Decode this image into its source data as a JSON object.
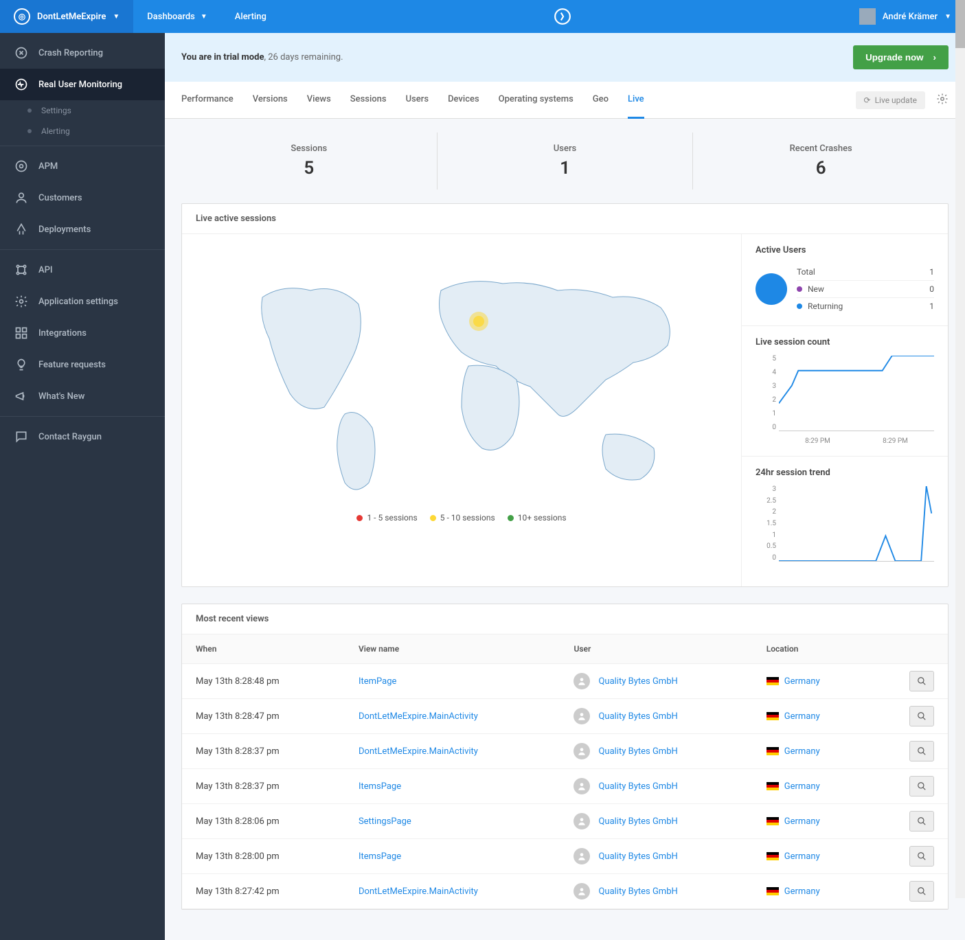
{
  "topbar": {
    "app_name": "DontLetMeExpire",
    "nav": [
      "Dashboards",
      "Alerting"
    ],
    "user_name": "André Krämer"
  },
  "sidebar": {
    "sections": [
      {
        "items": [
          {
            "label": "Crash Reporting",
            "icon": "crash"
          },
          {
            "label": "Real User Monitoring",
            "icon": "pulse",
            "active": true,
            "subitems": [
              "Settings",
              "Alerting"
            ]
          }
        ]
      },
      {
        "items": [
          {
            "label": "APM",
            "icon": "apm"
          },
          {
            "label": "Customers",
            "icon": "customers"
          },
          {
            "label": "Deployments",
            "icon": "deployments"
          }
        ]
      },
      {
        "items": [
          {
            "label": "API",
            "icon": "api"
          },
          {
            "label": "Application settings",
            "icon": "gear"
          },
          {
            "label": "Integrations",
            "icon": "integrations"
          },
          {
            "label": "Feature requests",
            "icon": "bulb"
          },
          {
            "label": "What's New",
            "icon": "megaphone"
          }
        ]
      },
      {
        "items": [
          {
            "label": "Contact Raygun",
            "icon": "chat"
          }
        ]
      }
    ]
  },
  "trial": {
    "bold": "You are in trial mode",
    "rest": ", 26 days remaining.",
    "upgrade": "Upgrade now"
  },
  "tabs": {
    "items": [
      "Performance",
      "Versions",
      "Views",
      "Sessions",
      "Users",
      "Devices",
      "Operating systems",
      "Geo",
      "Live"
    ],
    "active": "Live",
    "live_update": "Live update"
  },
  "kpis": [
    {
      "label": "Sessions",
      "value": "5"
    },
    {
      "label": "Users",
      "value": "1"
    },
    {
      "label": "Recent Crashes",
      "value": "6"
    }
  ],
  "map_panel": {
    "title": "Live active sessions",
    "legend": [
      {
        "color": "#e53935",
        "label": "1 - 5 sessions"
      },
      {
        "color": "#fdd835",
        "label": "5 - 10 sessions"
      },
      {
        "color": "#43a047",
        "label": "10+ sessions"
      }
    ],
    "active_users": {
      "title": "Active Users",
      "rows": [
        {
          "label": "Total",
          "value": "1"
        },
        {
          "dot": "#8e44ad",
          "label": "New",
          "value": "0"
        },
        {
          "dot": "#1e88e5",
          "label": "Returning",
          "value": "1"
        }
      ]
    },
    "live_count": {
      "title": "Live session count",
      "y_ticks": [
        "5",
        "4",
        "3",
        "2",
        "1",
        "0"
      ],
      "x_ticks": [
        "8:29 PM",
        "8:29 PM"
      ]
    },
    "trend": {
      "title": "24hr session trend",
      "y_ticks": [
        "3",
        "2.5",
        "2",
        "1.5",
        "1",
        "0.5",
        "0"
      ]
    }
  },
  "chart_data": [
    {
      "type": "line",
      "title": "Live session count",
      "ylabel": "",
      "xlabel": "",
      "x": [
        "8:29 PM",
        "8:29 PM"
      ],
      "series": [
        {
          "name": "sessions",
          "values": [
            3,
            4,
            4,
            4,
            4,
            4,
            4,
            5,
            5,
            5
          ]
        }
      ],
      "ylim": [
        0,
        5
      ]
    },
    {
      "type": "line",
      "title": "24hr session trend",
      "ylabel": "",
      "xlabel": "",
      "series": [
        {
          "name": "sessions",
          "values": [
            0,
            0,
            0,
            0,
            0,
            0,
            0,
            0,
            0,
            0,
            0,
            1,
            0,
            0,
            3,
            2
          ]
        }
      ],
      "ylim": [
        0,
        3
      ]
    }
  ],
  "recent": {
    "title": "Most recent views",
    "columns": [
      "When",
      "View name",
      "User",
      "Location",
      ""
    ],
    "rows": [
      {
        "when": "May 13th 8:28:48 pm",
        "view": "ItemPage",
        "user": "Quality Bytes GmbH",
        "loc": "Germany",
        "flag": "de"
      },
      {
        "when": "May 13th 8:28:47 pm",
        "view": "DontLetMeExpire.MainActivity",
        "user": "Quality Bytes GmbH",
        "loc": "Germany",
        "flag": "de"
      },
      {
        "when": "May 13th 8:28:37 pm",
        "view": "DontLetMeExpire.MainActivity",
        "user": "Quality Bytes GmbH",
        "loc": "Germany",
        "flag": "de"
      },
      {
        "when": "May 13th 8:28:37 pm",
        "view": "ItemsPage",
        "user": "Quality Bytes GmbH",
        "loc": "Germany",
        "flag": "de"
      },
      {
        "when": "May 13th 8:28:06 pm",
        "view": "SettingsPage",
        "user": "Quality Bytes GmbH",
        "loc": "Germany",
        "flag": "de"
      },
      {
        "when": "May 13th 8:28:00 pm",
        "view": "ItemsPage",
        "user": "Quality Bytes GmbH",
        "loc": "Germany",
        "flag": "de"
      },
      {
        "when": "May 13th 8:27:42 pm",
        "view": "DontLetMeExpire.MainActivity",
        "user": "Quality Bytes GmbH",
        "loc": "Germany",
        "flag": "de"
      }
    ]
  }
}
